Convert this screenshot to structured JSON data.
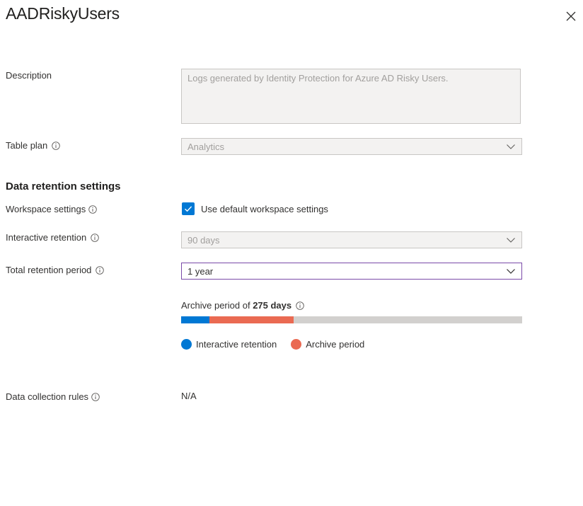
{
  "panel": {
    "title": "AADRiskyUsers"
  },
  "fields": {
    "description_label": "Description",
    "description_value": "Logs generated by Identity Protection for Azure AD Risky Users.",
    "table_plan_label": "Table plan",
    "table_plan_value": "Analytics"
  },
  "retention": {
    "section_title": "Data retention settings",
    "workspace_label": "Workspace settings",
    "use_default_label": "Use default workspace settings",
    "use_default_checked": true,
    "interactive_label": "Interactive retention",
    "interactive_value": "90 days",
    "total_label": "Total retention period",
    "total_value": "1 year",
    "archive_prefix": "Archive period of",
    "archive_days": "275 days",
    "bar": {
      "interactive_days": 30,
      "archive_days": 90,
      "total_days": 365
    },
    "legend": {
      "interactive": "Interactive retention",
      "archive": "Archive period"
    },
    "colors": {
      "interactive": "#0078d4",
      "archive": "#ea6a52",
      "empty": "#d2d0ce"
    }
  },
  "dcr": {
    "label": "Data collection rules",
    "value": "N/A"
  }
}
